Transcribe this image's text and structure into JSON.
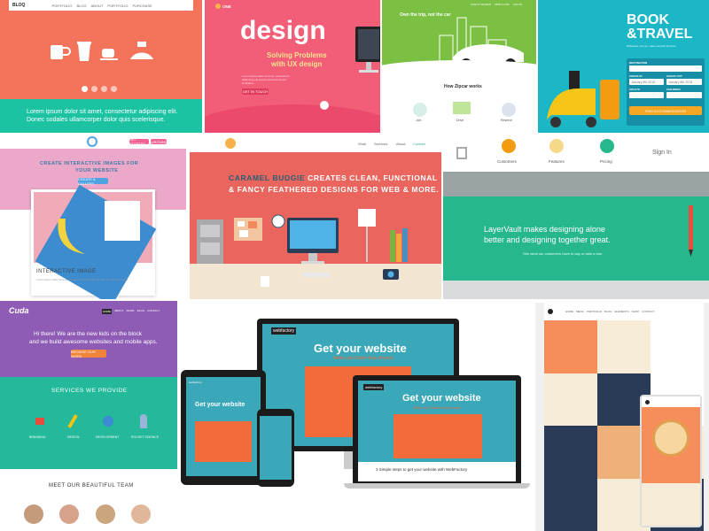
{
  "bloq": {
    "logo": "BLOQ",
    "nav": [
      "PORTFOLIO",
      "BLOG",
      "ABOUT",
      "PORTFOLIO",
      "PURCHASE"
    ],
    "body": "Lorem ipsum dolor sit amet, consectetur adipiscing elit. Donec sodales ullamcorper dolor quis scelerisque.",
    "colors": {
      "top": "#f4735b",
      "bottom": "#1bc3a3"
    }
  },
  "design_tile": {
    "logo": "ONE",
    "heading": "design",
    "sub1": "Solving Problems",
    "sub2": "with UX design",
    "body": "Lorem ipsum dolor sit amet, consectetur adipiscing elit sed do eiusmod tempor incididunt.",
    "cta": "GET IN TOUCH",
    "colors": {
      "bg": "#f25d77"
    }
  },
  "zipcar": {
    "tagline": "Own the trip, not the car",
    "nav": [
      "HOW IT WORKS",
      "FIND A CAR",
      "LOG IN"
    ],
    "how_title": "How Zipcar works",
    "steps": [
      "Join",
      "Drive",
      "Reserve"
    ],
    "colors": {
      "green": "#7bc043"
    }
  },
  "book_travel": {
    "title_line1": "BOOK",
    "title_line2": "&TRAVEL",
    "subtitle": "Whenever you go, make yourself at home",
    "form_labels": [
      "DESTINATION",
      "CHECK IN",
      "CHECK OUT",
      "ADULTS",
      "CHILDREN"
    ],
    "check_in": "January 5th 2018",
    "check_out": "January 8th 2018",
    "cta": "FIND ACCOMMODATION",
    "colors": {
      "bg": "#1bb7c7",
      "cta": "#f5a623"
    }
  },
  "interactive": {
    "heading_line1": "CREATE INTERACTIVE IMAGES FOR",
    "heading_line2": "YOUR WEBSITE",
    "cta": "CREATE A GALLERY",
    "card_label": "INTERACTIVE IMAGE",
    "card_body": "Lorem ipsum dolor sit amet consectetur adipiscing elit sed do eiusmod tempor",
    "nav_buttons": [
      "GET STARTED",
      "PURCHASE"
    ],
    "colors": {
      "bg": "#eba8c8",
      "accent": "#4fa3e0"
    }
  },
  "caramel": {
    "nav": [
      "Work",
      "Services",
      "About",
      "Contact"
    ],
    "headline_brand": "CARAMEL BUDGIE",
    "headline_rest": "CREATES CLEAN, FUNCTIONAL",
    "headline_line2": "& FANCY FEATHERED DESIGNS FOR WEB & MORE.",
    "colors": {
      "wall": "#e9655d",
      "desk": "#f2e6d3",
      "brand": "#2a5f75"
    }
  },
  "layervault": {
    "nav": [
      "Customers",
      "Features",
      "Pricing"
    ],
    "signin": "Sign In",
    "headline_line1": "LayerVault makes designing alone",
    "headline_line2": "better and designing together great.",
    "subline": "See what our customers have to say or take a tour",
    "colors": {
      "bg": "#27b78c"
    }
  },
  "cuda": {
    "logo": "Cuda",
    "nav": [
      "HOME",
      "ABOUT",
      "WORK",
      "BLOG",
      "CONTACT"
    ],
    "hero_line1": "Hi there! We are the new kids on the block",
    "hero_line2": "and we build awesome websites and mobile apps.",
    "cta": "BROWSE OUR WORK",
    "services_title": "SERVICES WE PROVIDE",
    "services": [
      "BRANDING",
      "DESIGN",
      "DEVELOPMENT",
      "ROCKET SCIENCE"
    ],
    "team_title": "MEET OUR BEAUTIFUL TEAM",
    "colors": {
      "hero": "#8e5bb5",
      "services": "#23b99a",
      "cta": "#f0843a"
    }
  },
  "webfactory": {
    "brand": "webfactory",
    "headline": "Get your website",
    "subhead": "Better and Faster than Anyone",
    "steps_line": "3 Simple steps to get your website with WebFactory",
    "colors": {
      "teal": "#3aa8b8",
      "orange": "#f26b3a"
    }
  },
  "food": {
    "nav": [
      "HOME",
      "MENU",
      "PORTFOLIO",
      "BLOG",
      "ELEMENTS",
      "SHOP",
      "CONTACT"
    ],
    "colors": {
      "orange": "#f78d5a",
      "navy": "#2a3b57",
      "cream": "#f6ecd7"
    }
  }
}
